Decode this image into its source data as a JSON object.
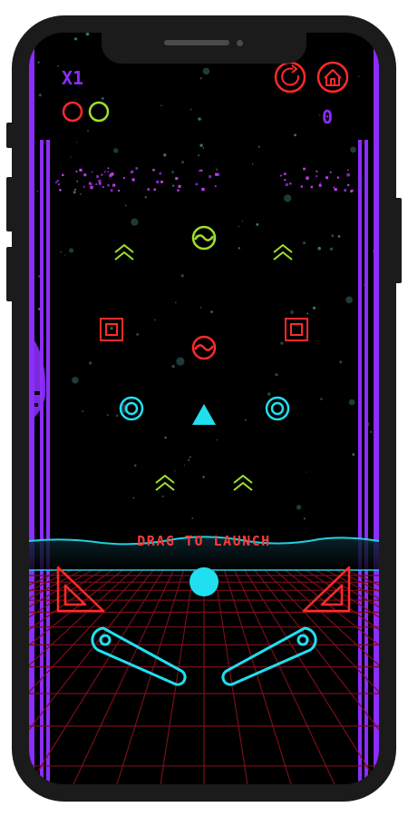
{
  "hud": {
    "multiplier": "X1",
    "score": "0",
    "balls_remaining": 2,
    "ball_colors": [
      "#ff2a2a",
      "#9fff2a"
    ]
  },
  "prompt": {
    "launch_text": "DRAG TO LAUNCH"
  },
  "buttons": {
    "restart": "restart-icon",
    "home": "home-icon"
  },
  "colors": {
    "purple": "#8c2cff",
    "red": "#ff2a2a",
    "cyan": "#20e0f0",
    "lime": "#9fe02a",
    "bg": "#000000"
  }
}
